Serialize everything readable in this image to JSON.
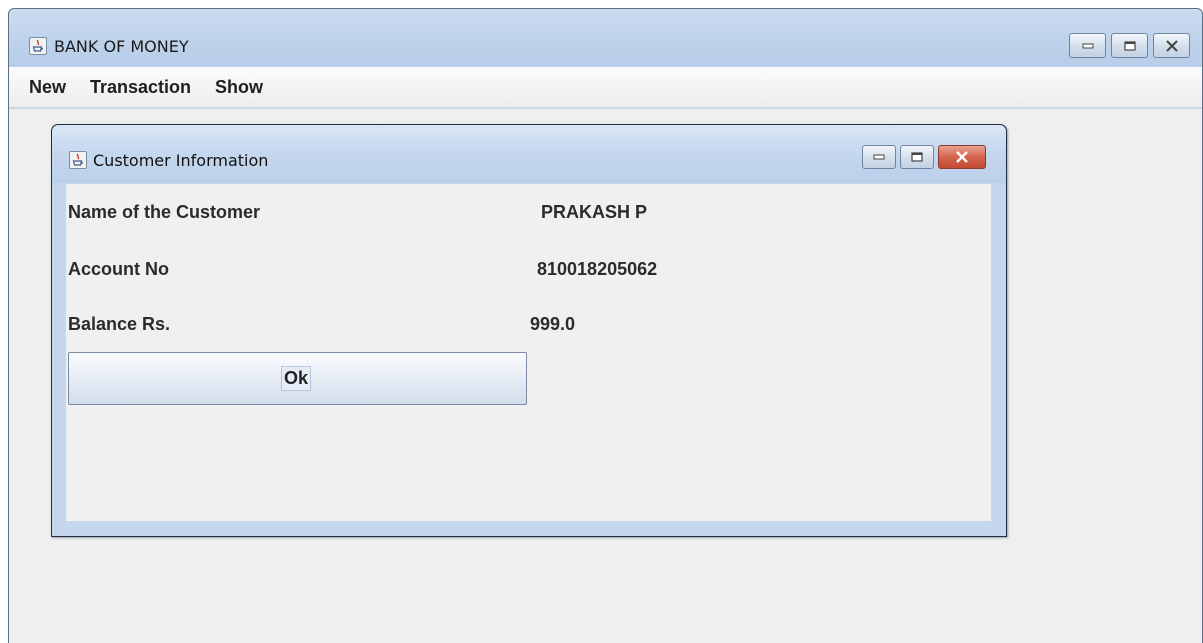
{
  "main_window": {
    "title": "BANK OF MONEY",
    "icon": "java-cup-icon",
    "controls": [
      "minimize-icon",
      "maximize-icon",
      "close-icon"
    ]
  },
  "menu": {
    "items": [
      {
        "label": "New"
      },
      {
        "label": "Transaction"
      },
      {
        "label": "Show"
      }
    ]
  },
  "dialog": {
    "title": "Customer Information",
    "icon": "java-cup-icon",
    "fields": {
      "name_label": "Name of the Customer",
      "name_value": "PRAKASH P",
      "account_label": "Account No",
      "account_value": "810018205062",
      "balance_label": "Balance Rs.",
      "balance_value": "999.0"
    },
    "ok_label": "Ok",
    "close_button_color": "#d4634c"
  }
}
